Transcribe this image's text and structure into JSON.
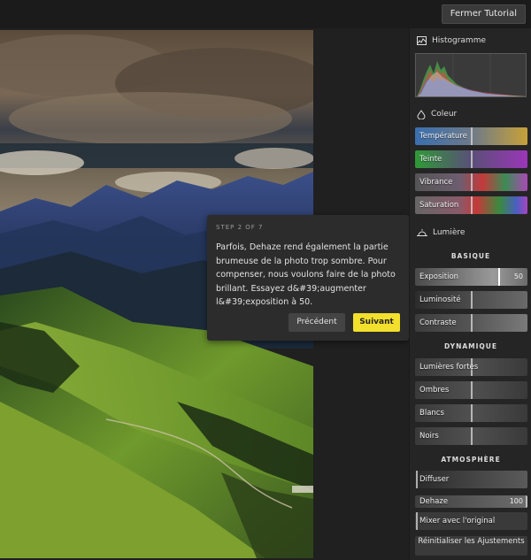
{
  "toolbar": {
    "tutorial_button": "Fermer Tutorial"
  },
  "tooltip": {
    "step": "STEP 2 OF 7",
    "text": "Parfois, Dehaze rend également la partie brumeuse de la photo trop sombre. Pour compenser, nous voulons faire de la photo brillant. Essayez d&#39;augmenter l&#39;exposition à 50.",
    "prev": "Précédent",
    "next": "Suivant",
    "next_color": "#f3e02c"
  },
  "panel": {
    "histogram": {
      "title": "Histogramme",
      "icon": "histogram-icon"
    },
    "color": {
      "title": "Coleur",
      "icon": "droplet-icon",
      "sliders": [
        {
          "label": "Température",
          "value": 0.5
        },
        {
          "label": "Teinte",
          "value": 0.5
        },
        {
          "label": "Vibrance",
          "value": 0.5
        },
        {
          "label": "Saturation",
          "value": 0.5
        }
      ]
    },
    "light": {
      "title": "Lumière",
      "icon": "sun-icon",
      "basic": {
        "title": "BASIQUE",
        "exposure": {
          "label": "Exposition",
          "value": "50",
          "position": 0.75
        },
        "luminosity": {
          "label": "Luminosité",
          "position": 0.5
        },
        "contrast": {
          "label": "Contraste",
          "position": 0.5
        }
      },
      "dynamic": {
        "title": "DYNAMIQUE",
        "sliders": [
          {
            "label": "Lumières fortes",
            "position": 0.5
          },
          {
            "label": "Ombres",
            "position": 0.5
          },
          {
            "label": "Blancs",
            "position": 0.5
          },
          {
            "label": "Noirs",
            "position": 0.5
          }
        ]
      },
      "atmosphere": {
        "title": "ATMOSPHÈRE",
        "diffuse": {
          "label": "Diffuser",
          "position": 0.0
        },
        "dehaze": {
          "label": "Dehaze",
          "value": "100",
          "position": 1.0
        },
        "mix": {
          "label": "Mixer avec l'original"
        }
      }
    },
    "reset": "Réinitialiser les Ajustements"
  },
  "colors": {
    "accent": "#f3e02c",
    "panel": "#252525",
    "tooltip": "#2c2c2c"
  }
}
